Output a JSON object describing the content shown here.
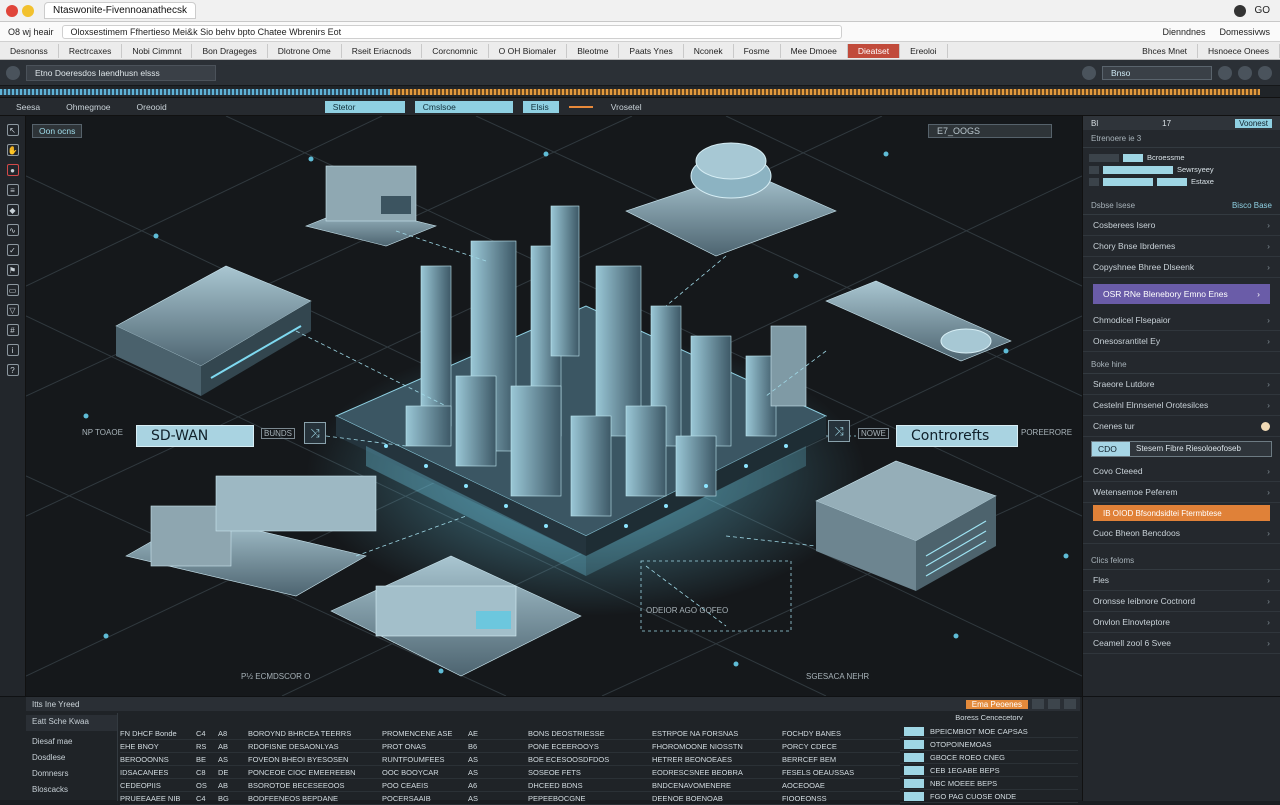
{
  "browser": {
    "tab_title": "Ntaswonite-Fivennoanathecsk",
    "right_items": [
      "GO",
      "GO"
    ]
  },
  "address": {
    "left": "O8  wj heair",
    "url": "Oloxsestimem Ffhertieso Mei&k Sio behv bpto   Chatee Wbrenirs Eot",
    "right": [
      "Dienndnes",
      "Domessivws"
    ]
  },
  "menu": {
    "items": [
      "Desnonss",
      "Rectrcaxes",
      "Nobi Cimmnt",
      "Bon Drageges",
      "Dlotrone Ome",
      "Rseit Eriacnods",
      "Corcnomnic",
      "O OH Biomaler",
      "Bleotme",
      "Paats Ynes",
      "Nconek",
      "Fosme",
      "Mee Dmoee",
      "Dieatset",
      "Ereoloi"
    ],
    "right": [
      "Bhces Mnet",
      "Hsnoece Onees"
    ]
  },
  "toolbar": {
    "combo": "Etno  Doeresdos Iaendhusn elsss",
    "field": "Bnso"
  },
  "subtabs": {
    "items": [
      "Seesa",
      "Ohmegmoe",
      "Oreooid"
    ],
    "cyan_a": "Stetor",
    "cyan_b": "Cmslsoe",
    "cyan_c": "Elsis",
    "extra": "Vrosetel"
  },
  "canvas": {
    "label_tl": "Oon ocns",
    "label_tr": "E7_OOGS",
    "left_node": "SD-WAN",
    "right_node": "Controrefts",
    "left_tag": "NP TOAOE",
    "right_tag": "POREERORE",
    "bottom_left_tag": "P½  ECMDSCOR O",
    "bottom_mid_tag": "ODEIOR AGO GOFEO",
    "bottom_right_tag": "SGESACA  NEHR",
    "chip_left": "BUNDS",
    "chip_right": "NOWE"
  },
  "panel": {
    "header": [
      "Bl",
      "17",
      "Voonest"
    ],
    "section1": "Etrenoere ie 3",
    "mini_rows": [
      "Bcroessme",
      "Sewrsyeey",
      "Estaxe"
    ],
    "section2": "Dsbse Isese",
    "section2_right": "Bisco Base",
    "rows_a": [
      "Cosberees Isero",
      "Chory Bnse Ibrdemes",
      "Copyshnee Bhree Dlseenk"
    ],
    "purple": "OSR RNe Blenebory Emno Enes",
    "rows_b": [
      "Chmodicel Flsepaior",
      "Onesosrantitel Ey"
    ],
    "section3": "Boke hine",
    "rows_c": [
      "Sraeore Lutdore",
      "Cestelnl Elnnsenel Orotesilces",
      "Cnenes tur"
    ],
    "input_a": "CDO",
    "input_b": "Stesem Fibre Riesoloeofoseb",
    "rows_d": [
      "Covo Cteeed",
      "Wetensemoe Peferem"
    ],
    "orange": "IB OIOD  Bfsondsidtei Ftermbtese",
    "rows_e": [
      "Cuoc Bheon Bencdoos"
    ],
    "section4": "Clics feloms",
    "rows_f": [
      "Fles",
      "Oronsse Ieibnore Coctnord",
      "Onvlon Elnovteptore",
      "Ceamell zool 6 Svee"
    ]
  },
  "bottom": {
    "head_left": "Itts Ine  Yreed",
    "head_orange": "Ema Peoenes",
    "left_items": [
      "Eatt Sche Kwaa",
      "Diesaf mae",
      "Dosdlese",
      "Domnesrs",
      "Bloscacks"
    ],
    "side_header": "Boress Cencecetorv",
    "rows": [
      [
        "FN DHCF Bonde",
        "C4",
        "A8",
        "BOROYND BHRCEA TEERRS",
        "PROMENCENE ASE",
        "AE",
        "BONS DEOSTRIESSE",
        "ESTRPOE NA FORSNAS",
        "FOCHDY BANES"
      ],
      [
        "EHE BNOY",
        "RS",
        "AB",
        "RDOFISNE DESAONLYAS",
        "PROT ONAS",
        "B6",
        "PONE ECEEROOYS",
        "FHOROMOONE NIOSSTN",
        "PORCY CDECE"
      ],
      [
        "BEROOONNS",
        "BE",
        "AS",
        "FOVEON BHEOI BYESOSEN",
        "RUNTFOUMFEES",
        "AS",
        "BOE ECESOOSDFDOS",
        "HETRER BEONOEAES",
        "BERRCEF BEM"
      ],
      [
        "IDSACANEES",
        "C8",
        "DE",
        "PONCEOE CIOC EMEEREEBN",
        "OOC BOOYCAR",
        "AS",
        "SOSEOE FETS",
        "EODRESCSNEE BEOBRA",
        "FESELS OEAUSSAS"
      ],
      [
        "CEDEOPIIS",
        "OS",
        "AB",
        "BSOROTOE BECESEEOOS",
        "POO CEAEIS",
        "A6",
        "DHCEED BDNS",
        "BNDCENAVOMENERE",
        "AOCEOOAE"
      ],
      [
        "PRUEEAAEE NIB",
        "C4",
        "BG",
        "BODFEENEOS BEPDANE",
        "POCERSAAIB",
        "AS",
        "PEPEEBOCGNE",
        "DEENOE BOENOAB",
        "FIOOEONSS"
      ]
    ],
    "side_rows": [
      "BPEICMBIOT MOE CAPSAS",
      "OTOPOINEMOAS",
      "GBOCE ROEO CNEG",
      "CEB 1EGABE BEPS",
      "NBC MOEEE BEPS",
      "FGO PAG CUOSE ONDE"
    ]
  }
}
